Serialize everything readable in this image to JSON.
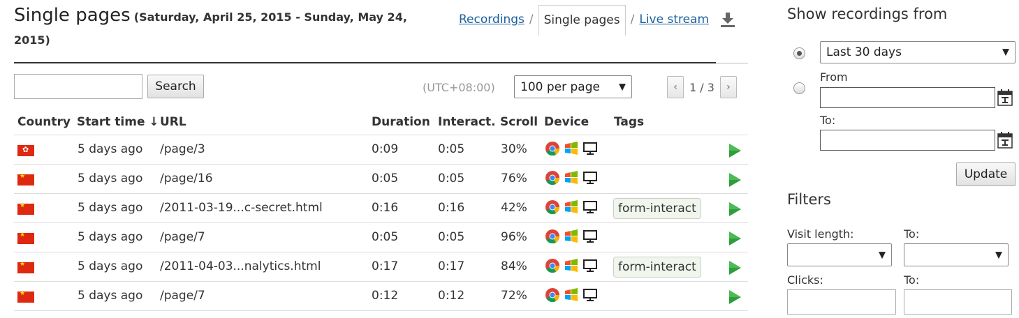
{
  "header": {
    "title": "Single pages",
    "date_range": "(Saturday, April 25, 2015 - Sunday, May 24, 2015)",
    "nav": {
      "recordings": "Recordings",
      "separator": "/",
      "single_pages": "Single pages",
      "live_stream": "Live stream"
    }
  },
  "toolbar": {
    "search_placeholder": "",
    "search_label": "Search",
    "timezone": "(UTC+08:00)",
    "per_page": "100 per page",
    "pager": {
      "prev": "‹",
      "info": "1 / 3",
      "next": "›"
    }
  },
  "table": {
    "columns": [
      "Country",
      "Start time ↓",
      "URL",
      "Duration",
      "Interact.",
      "Scroll",
      "Device",
      "Tags"
    ],
    "rows": [
      {
        "flag": "hk",
        "start": "5 days ago",
        "url": "/page/3",
        "duration": "0:09",
        "interact": "0:05",
        "scroll": "30%",
        "tag": ""
      },
      {
        "flag": "cn",
        "start": "5 days ago",
        "url": "/page/16",
        "duration": "0:05",
        "interact": "0:05",
        "scroll": "76%",
        "tag": ""
      },
      {
        "flag": "cn",
        "start": "5 days ago",
        "url": "/2011-03-19...c-secret.html",
        "duration": "0:16",
        "interact": "0:16",
        "scroll": "42%",
        "tag": "form-interact"
      },
      {
        "flag": "cn",
        "start": "5 days ago",
        "url": "/page/7",
        "duration": "0:05",
        "interact": "0:05",
        "scroll": "96%",
        "tag": ""
      },
      {
        "flag": "cn",
        "start": "5 days ago",
        "url": "/2011-04-03...nalytics.html",
        "duration": "0:17",
        "interact": "0:17",
        "scroll": "84%",
        "tag": "form-interact"
      },
      {
        "flag": "cn",
        "start": "5 days ago",
        "url": "/page/7",
        "duration": "0:12",
        "interact": "0:12",
        "scroll": "72%",
        "tag": ""
      }
    ]
  },
  "sidebar": {
    "show_title": "Show recordings from",
    "range_option": "Last 30 days",
    "from_label": "From",
    "to_label": "To:",
    "update_label": "Update",
    "filters_title": "Filters",
    "visit_length_label": "Visit length:",
    "visit_to_label": "To:",
    "clicks_label": "Clicks:",
    "clicks_to_label": "To:"
  },
  "colors": {
    "link": "#1a5f9e",
    "play": "#2e9e3a",
    "flag": "#de2910",
    "tag_bg": "#f0f6ec"
  }
}
